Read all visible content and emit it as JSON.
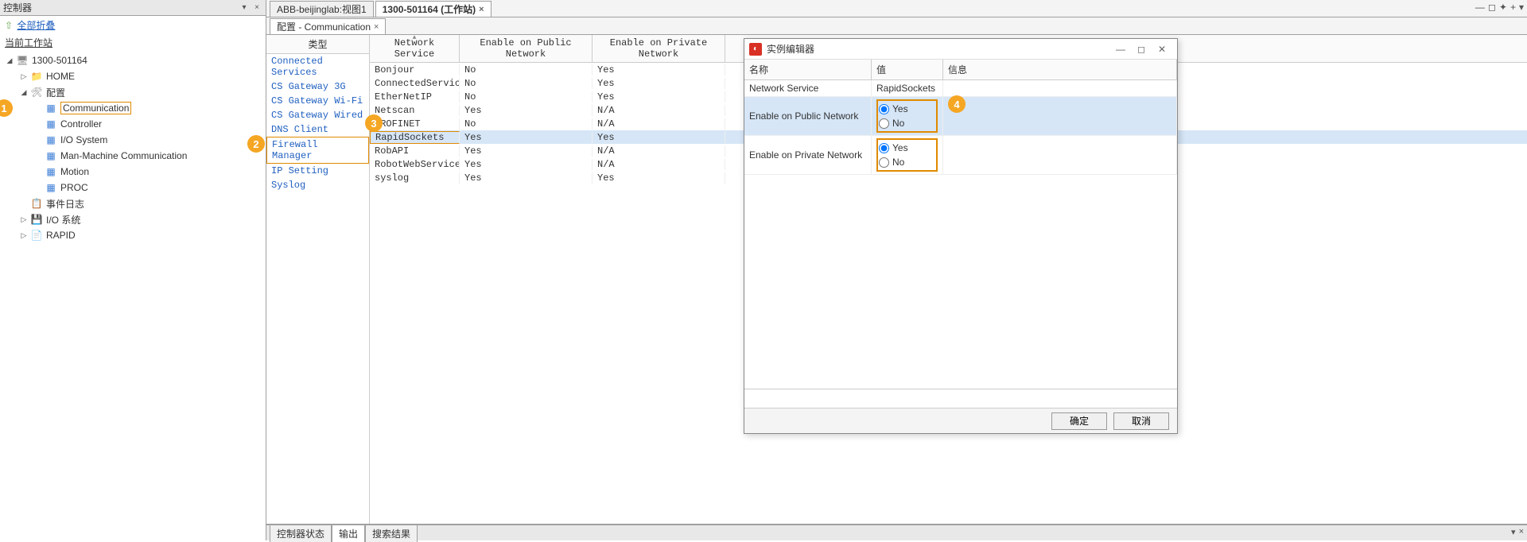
{
  "left_panel": {
    "title": "控制器",
    "collapse_all": "全部折叠",
    "current_station": "当前工作站",
    "tree": [
      {
        "depth": 0,
        "exp": "open",
        "icon": "ctrl",
        "label": "1300-501164"
      },
      {
        "depth": 1,
        "exp": "closed",
        "icon": "folder",
        "label": "HOME"
      },
      {
        "depth": 1,
        "exp": "open",
        "icon": "cfg",
        "label": "配置"
      },
      {
        "depth": 2,
        "exp": "",
        "icon": "grid",
        "label": "Communication",
        "boxed": true,
        "badge": "1"
      },
      {
        "depth": 2,
        "exp": "",
        "icon": "grid",
        "label": "Controller"
      },
      {
        "depth": 2,
        "exp": "",
        "icon": "grid",
        "label": "I/O System"
      },
      {
        "depth": 2,
        "exp": "",
        "icon": "grid",
        "label": "Man-Machine Communication"
      },
      {
        "depth": 2,
        "exp": "",
        "icon": "grid",
        "label": "Motion"
      },
      {
        "depth": 2,
        "exp": "",
        "icon": "grid",
        "label": "PROC"
      },
      {
        "depth": 1,
        "exp": "",
        "icon": "log",
        "label": "事件日志"
      },
      {
        "depth": 1,
        "exp": "closed",
        "icon": "io",
        "label": "I/O 系统"
      },
      {
        "depth": 1,
        "exp": "closed",
        "icon": "rapid",
        "label": "RAPID"
      }
    ]
  },
  "top_tabs": [
    {
      "label": "ABB-beijinglab:视图1",
      "active": false,
      "closable": false
    },
    {
      "label": "1300-501164 (工作站)",
      "active": true,
      "closable": true
    }
  ],
  "sub_tab": {
    "label": "配置 - Communication"
  },
  "typelist": {
    "header": "类型",
    "items": [
      {
        "label": "Connected Services"
      },
      {
        "label": "CS Gateway 3G"
      },
      {
        "label": "CS Gateway Wi-Fi"
      },
      {
        "label": "CS Gateway Wired"
      },
      {
        "label": "DNS Client"
      },
      {
        "label": "Firewall Manager",
        "boxed": true,
        "badge": "2"
      },
      {
        "label": "IP Setting"
      },
      {
        "label": "Syslog"
      }
    ]
  },
  "grid": {
    "columns": [
      "Network Service",
      "Enable on Public Network",
      "Enable on Private Network"
    ],
    "rows": [
      {
        "c": [
          "Bonjour",
          "No",
          "Yes"
        ]
      },
      {
        "c": [
          "ConnectedServices",
          "No",
          "Yes"
        ]
      },
      {
        "c": [
          "EtherNetIP",
          "No",
          "Yes"
        ]
      },
      {
        "c": [
          "Netscan",
          "Yes",
          "N/A"
        ]
      },
      {
        "c": [
          "PROFINET",
          "No",
          "N/A"
        ]
      },
      {
        "c": [
          "RapidSockets",
          "Yes",
          "Yes"
        ],
        "selected": true,
        "box0": true,
        "badge": "3"
      },
      {
        "c": [
          "RobAPI",
          "Yes",
          "N/A"
        ]
      },
      {
        "c": [
          "RobotWebServices",
          "Yes",
          "N/A"
        ]
      },
      {
        "c": [
          "syslog",
          "Yes",
          "Yes"
        ]
      }
    ]
  },
  "bottom_tabs": {
    "items": [
      {
        "label": "控制器状态"
      },
      {
        "label": "输出",
        "active": true
      },
      {
        "label": "搜索结果"
      }
    ]
  },
  "dialog": {
    "title": "实例编辑器",
    "columns": [
      "名称",
      "值",
      "信息"
    ],
    "rows": [
      {
        "name": "Network Service",
        "type": "text",
        "value": "RapidSockets"
      },
      {
        "name": "Enable on Public Network",
        "type": "radio",
        "options": [
          "Yes",
          "No"
        ],
        "selected": "Yes",
        "hl": true,
        "boxed": true,
        "badge": "4"
      },
      {
        "name": "Enable on Private Network",
        "type": "radio",
        "options": [
          "Yes",
          "No"
        ],
        "selected": "Yes",
        "boxed": true
      }
    ],
    "ok": "确定",
    "cancel": "取消"
  }
}
